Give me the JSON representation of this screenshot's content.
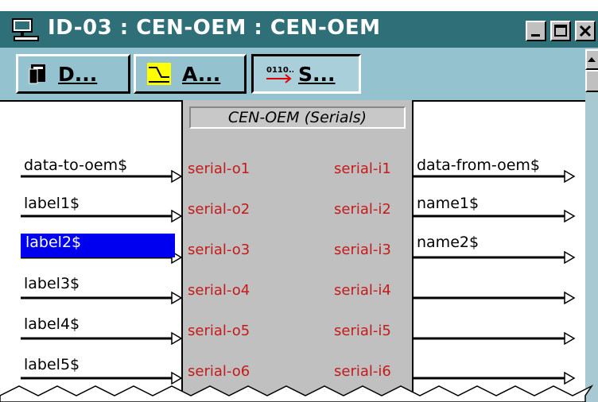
{
  "window": {
    "title": "ID-03 : CEN-OEM : CEN-OEM"
  },
  "toolbar": {
    "buttons": [
      {
        "label": "D...",
        "icon": "document-icon"
      },
      {
        "label": "A...",
        "icon": "analog-signal-icon"
      },
      {
        "label": "S...",
        "icon": "serial-icon",
        "pressed": true
      }
    ]
  },
  "block": {
    "title": "CEN-OEM (Serials)",
    "outputs": [
      "serial-o1",
      "serial-o2",
      "serial-o3",
      "serial-o4",
      "serial-o5",
      "serial-o6"
    ],
    "inputs": [
      "serial-i1",
      "serial-i2",
      "serial-i3",
      "serial-i4",
      "serial-i5",
      "serial-i6"
    ]
  },
  "left_signals": [
    "data-to-oem$",
    "label1$",
    "label2$",
    "label3$",
    "label4$",
    "label5$"
  ],
  "right_signals": [
    "data-from-oem$",
    "name1$",
    "name2$",
    "",
    "",
    ""
  ],
  "selected_signal": "label2$",
  "colors": {
    "titlebar": "#2f6f78",
    "toolbar": "#94c2cf",
    "block": "#c0c0c0",
    "port_text": "#c41a1a",
    "selection": "#0000f0"
  }
}
